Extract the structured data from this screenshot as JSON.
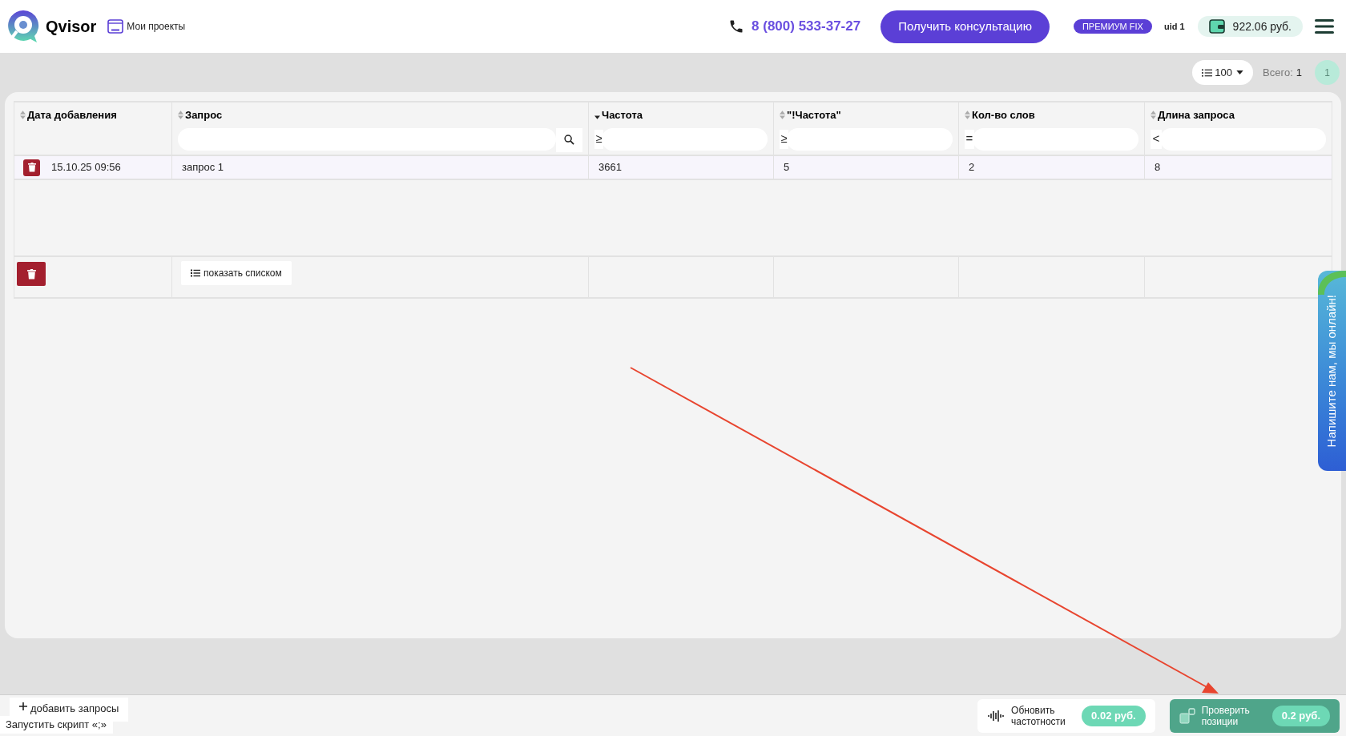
{
  "header": {
    "logo_text": "Qvisor",
    "projects_link": "Мои проекты",
    "phone": "8 (800) 533-37-27",
    "consult_button": "Получить консультацию",
    "plan_badge": "ПРЕМИУМ FIX",
    "uid": "uid 1",
    "balance": "922.06 руб."
  },
  "toolbar": {
    "page_size": "100",
    "total_label": "Всего:",
    "total_value": "1",
    "page": "1"
  },
  "table": {
    "columns": [
      {
        "label": "Дата добавления",
        "sorted": false
      },
      {
        "label": "Запрос",
        "sorted": false,
        "filter": {
          "kind": "search"
        }
      },
      {
        "label": "Частота",
        "sorted": true,
        "filter": {
          "kind": "operator",
          "operator": "≥"
        }
      },
      {
        "label": "\"!Частота\"",
        "sorted": false,
        "filter": {
          "kind": "operator",
          "operator": "≥"
        }
      },
      {
        "label": "Кол-во слов",
        "sorted": false,
        "filter": {
          "kind": "operator",
          "operator": "="
        }
      },
      {
        "label": "Длина запроса",
        "sorted": false,
        "filter": {
          "kind": "operator",
          "operator": "<"
        }
      }
    ],
    "rows": [
      {
        "cells": [
          "15.10.25 09:56",
          "запрос 1",
          "3661",
          "5",
          "2",
          "8"
        ]
      }
    ],
    "show_list_button": "показать списком"
  },
  "bottom_bar": {
    "add_button": "добавить запросы",
    "tooltip": "Запустить скрипт «;»",
    "actions": [
      {
        "kind": "secondary",
        "label": "Обновить частотности",
        "price": "0.02 руб."
      },
      {
        "kind": "primary",
        "label": "Проверить позиции",
        "price": "0.2 руб."
      }
    ]
  },
  "chat_tab": "Напишите нам, мы онлайн!"
}
